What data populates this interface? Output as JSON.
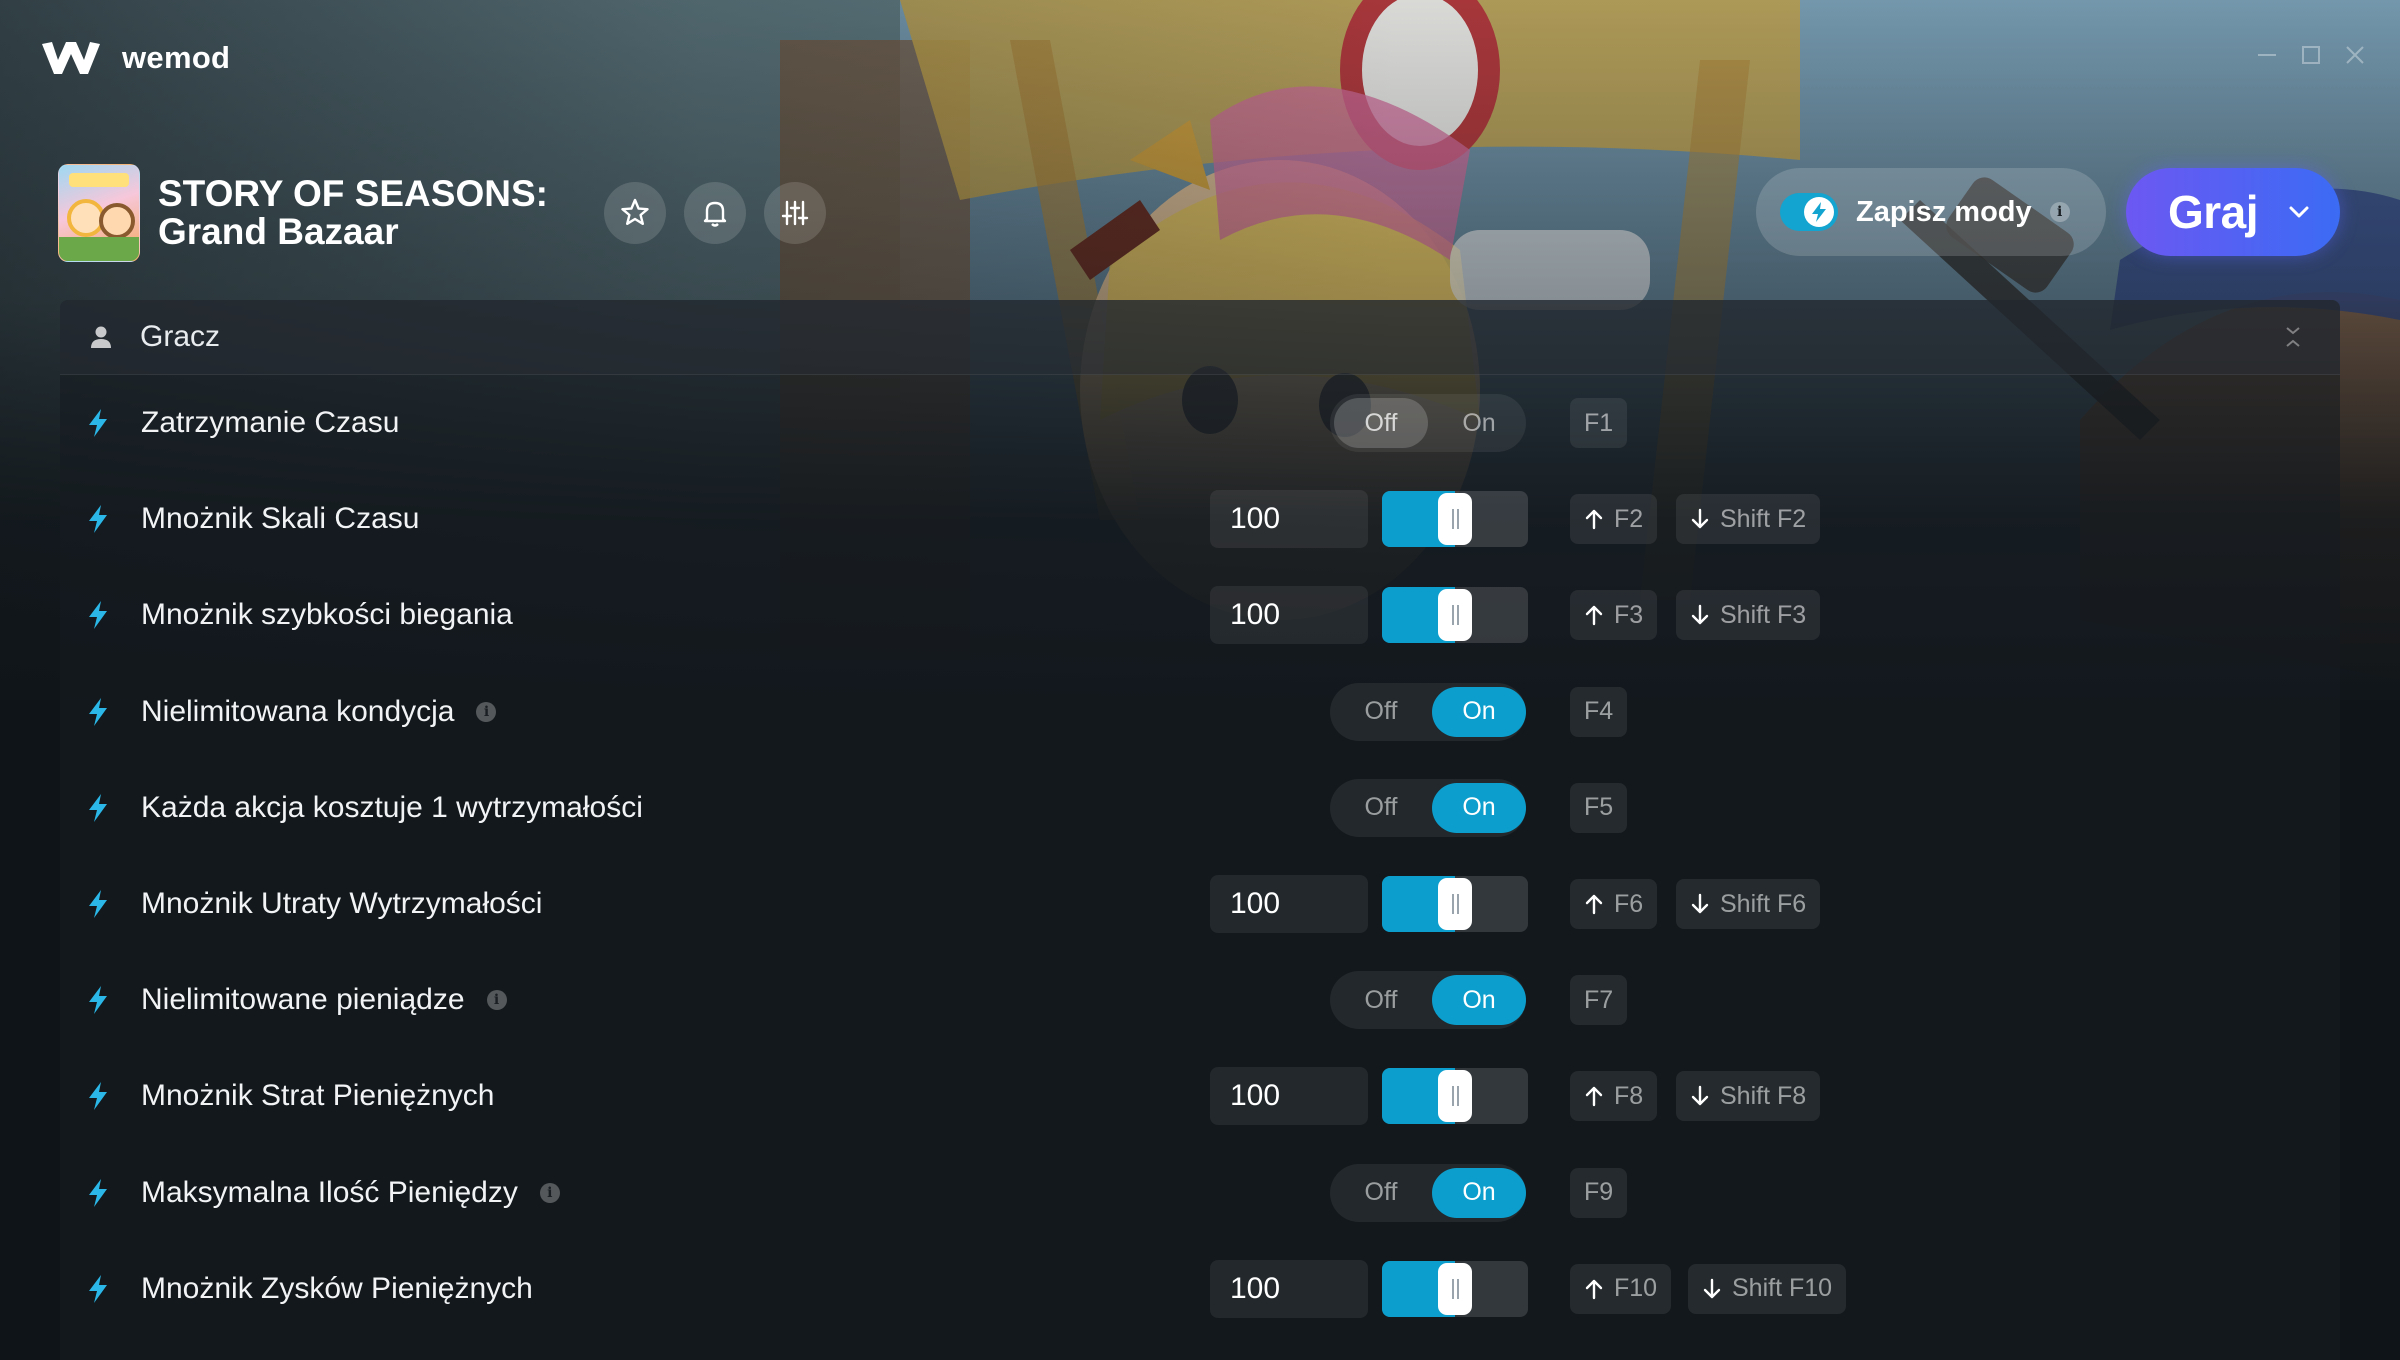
{
  "app": {
    "name": "wemod"
  },
  "game": {
    "title_line1": "STORY OF SEASONS:",
    "title_line2": "Grand Bazaar"
  },
  "header_actions": {
    "icons": [
      "star-icon",
      "bell-icon",
      "sliders-icon"
    ],
    "save_mods_label": "Zapisz mody",
    "save_mods_enabled": true,
    "play_label": "Graj"
  },
  "category": {
    "label": "Gracz"
  },
  "mods": [
    {
      "label": "Zatrzymanie Czasu",
      "type": "toggle",
      "state": "Off",
      "info": false,
      "keys": [
        "F1"
      ]
    },
    {
      "label": "Mnożnik Skali Czasu",
      "type": "slider",
      "value": "100",
      "fill": 0.5,
      "info": false,
      "keys": [
        "F2",
        "Shift F2"
      ]
    },
    {
      "label": "Mnożnik szybkości biegania",
      "type": "slider",
      "value": "100",
      "fill": 0.5,
      "info": false,
      "keys": [
        "F3",
        "Shift F3"
      ]
    },
    {
      "label": "Nielimitowana kondycja",
      "type": "toggle",
      "state": "On",
      "info": true,
      "keys": [
        "F4"
      ]
    },
    {
      "label": "Każda akcja kosztuje 1 wytrzymałości",
      "type": "toggle",
      "state": "On",
      "info": false,
      "keys": [
        "F5"
      ]
    },
    {
      "label": "Mnożnik Utraty Wytrzymałości",
      "type": "slider",
      "value": "100",
      "fill": 0.5,
      "info": false,
      "keys": [
        "F6",
        "Shift F6"
      ]
    },
    {
      "label": "Nielimitowane pieniądze",
      "type": "toggle",
      "state": "On",
      "info": true,
      "keys": [
        "F7"
      ]
    },
    {
      "label": "Mnożnik Strat Pieniężnych",
      "type": "slider",
      "value": "100",
      "fill": 0.5,
      "info": false,
      "keys": [
        "F8",
        "Shift F8"
      ]
    },
    {
      "label": "Maksymalna Ilość Pieniędzy",
      "type": "toggle",
      "state": "On",
      "info": true,
      "keys": [
        "F9"
      ]
    },
    {
      "label": "Mnożnik Zysków Pieniężnych",
      "type": "slider",
      "value": "100",
      "fill": 0.5,
      "info": false,
      "keys": [
        "F10",
        "Shift F10"
      ]
    }
  ],
  "toggle_labels": {
    "off": "Off",
    "on": "On"
  },
  "colors": {
    "accent": "#0c9fcd",
    "play_gradient_start": "#6c58f2",
    "play_gradient_end": "#3b6bf4",
    "bolt": "#2bb8e8",
    "background": "#0f1418"
  }
}
